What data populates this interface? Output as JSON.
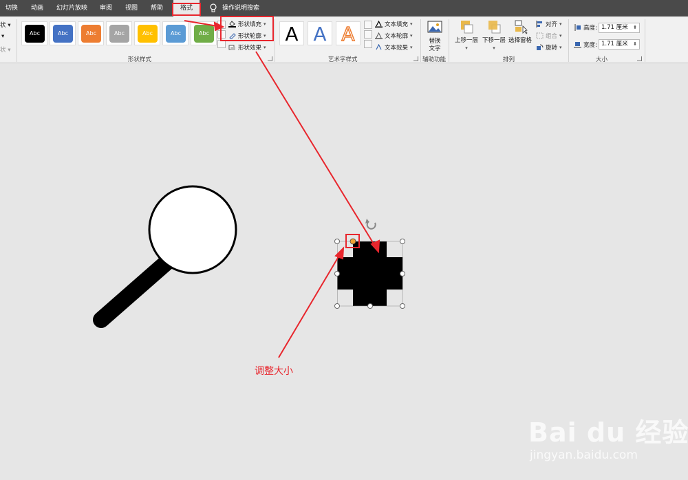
{
  "tabs": [
    {
      "label": "切换"
    },
    {
      "label": "动画"
    },
    {
      "label": "幻灯片放映"
    },
    {
      "label": "审阅"
    },
    {
      "label": "视图"
    },
    {
      "label": "帮助"
    },
    {
      "label": "格式",
      "active": true
    },
    {
      "label": "操作说明搜索"
    }
  ],
  "ribbon": {
    "left_cut": [
      "状 ▾",
      "▾",
      "状 ▾"
    ],
    "shape_styles": {
      "label": "形状样式",
      "swatches": [
        {
          "text": "Abc",
          "color": "#000000"
        },
        {
          "text": "Abc",
          "color": "#4472c4"
        },
        {
          "text": "Abc",
          "color": "#ed7d31"
        },
        {
          "text": "Abc",
          "color": "#a5a5a5"
        },
        {
          "text": "Abc",
          "color": "#ffc000"
        },
        {
          "text": "Abc",
          "color": "#5b9bd5"
        },
        {
          "text": "Abc",
          "color": "#70ad47"
        }
      ],
      "fill": "形状填充",
      "outline": "形状轮廓",
      "effects": "形状效果"
    },
    "wordart": {
      "label": "艺术字样式",
      "samples": [
        "A",
        "A",
        "A"
      ],
      "text_fill": "文本填充",
      "text_outline": "文本轮廓",
      "text_effects": "文本效果"
    },
    "accessibility": {
      "label": "辅助功能",
      "alt_text_line1": "替换",
      "alt_text_line2": "文字"
    },
    "arrange": {
      "label": "排列",
      "bring_forward": "上移一层",
      "send_backward": "下移一层",
      "selection_pane": "选择窗格",
      "align": "对齐",
      "group": "组合",
      "rotate": "旋转"
    },
    "size": {
      "label": "大小",
      "height_label": "高度:",
      "height_value": "1.71 厘米",
      "width_label": "宽度:",
      "width_value": "1.71 厘米"
    }
  },
  "canvas": {
    "caption": "调整大小",
    "watermark_logo": "Bai du 经验",
    "watermark_url": "jingyan.baidu.com"
  },
  "colors": {
    "accent_red": "#e8262d",
    "shape_black": "#000000",
    "handle_orange": "#f0a030"
  }
}
